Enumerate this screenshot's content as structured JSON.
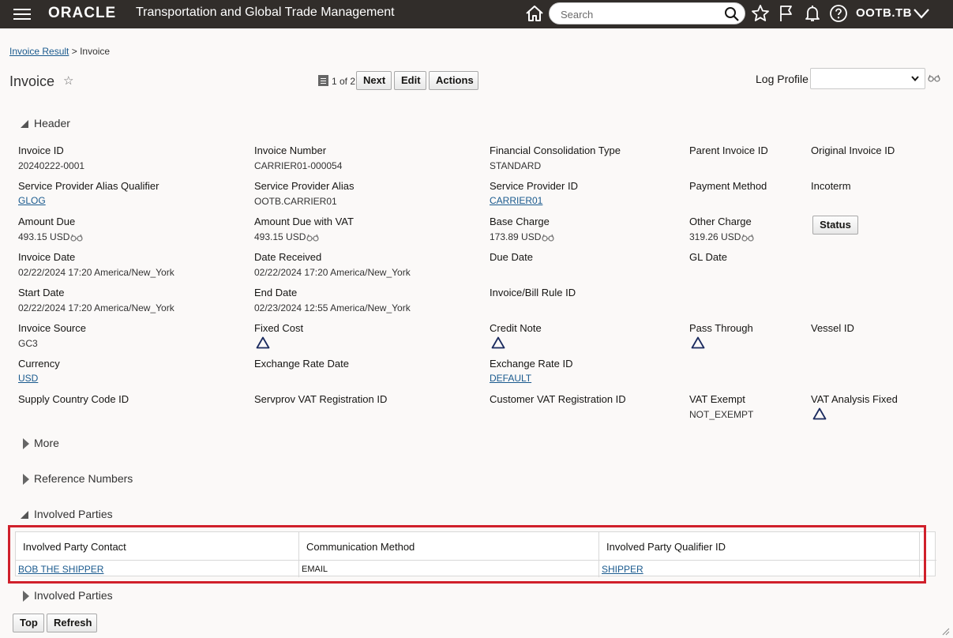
{
  "topbar": {
    "logo": "ORACLE",
    "app_title": "Transportation and Global Trade Management",
    "search_placeholder": "Search",
    "username": "OOTB.TB"
  },
  "breadcrumb": {
    "parent": "Invoice Result",
    "separator": ">",
    "current": "Invoice"
  },
  "page": {
    "title": "Invoice",
    "pager": "1 of 2",
    "buttons": {
      "next": "Next",
      "edit": "Edit",
      "actions": "Actions"
    },
    "log_profile_label": "Log Profile",
    "log_profile_value": ""
  },
  "header_section": {
    "title": "Header",
    "fields": {
      "invoice_id": {
        "label": "Invoice ID",
        "value": "20240222-0001"
      },
      "invoice_number": {
        "label": "Invoice Number",
        "value": "CARRIER01-000054"
      },
      "fin_consolidation_type": {
        "label": "Financial Consolidation Type",
        "value": "STANDARD"
      },
      "parent_invoice_id": {
        "label": "Parent Invoice ID",
        "value": ""
      },
      "original_invoice_id": {
        "label": "Original Invoice ID",
        "value": ""
      },
      "sp_alias_qualifier": {
        "label": "Service Provider Alias Qualifier",
        "value": "GLOG"
      },
      "sp_alias": {
        "label": "Service Provider Alias",
        "value": "OOTB.CARRIER01"
      },
      "sp_id": {
        "label": "Service Provider ID",
        "value": "CARRIER01"
      },
      "payment_method": {
        "label": "Payment Method",
        "value": ""
      },
      "incoterm": {
        "label": "Incoterm",
        "value": ""
      },
      "amount_due": {
        "label": "Amount Due",
        "value": "493.15 USD"
      },
      "amount_due_vat": {
        "label": "Amount Due with VAT",
        "value": "493.15 USD"
      },
      "base_charge": {
        "label": "Base Charge",
        "value": "173.89 USD"
      },
      "other_charge": {
        "label": "Other Charge",
        "value": "319.26 USD"
      },
      "status_button": "Status",
      "invoice_date": {
        "label": "Invoice Date",
        "value": "02/22/2024 17:20 America/New_York"
      },
      "date_received": {
        "label": "Date Received",
        "value": "02/22/2024 17:20 America/New_York"
      },
      "due_date": {
        "label": "Due Date",
        "value": ""
      },
      "gl_date": {
        "label": "GL Date",
        "value": ""
      },
      "start_date": {
        "label": "Start Date",
        "value": "02/22/2024 17:20 America/New_York"
      },
      "end_date": {
        "label": "End Date",
        "value": "02/23/2024 12:55 America/New_York"
      },
      "bill_rule_id": {
        "label": "Invoice/Bill Rule ID",
        "value": ""
      },
      "invoice_source": {
        "label": "Invoice Source",
        "value": "GC3"
      },
      "fixed_cost": {
        "label": "Fixed Cost"
      },
      "credit_note": {
        "label": "Credit Note"
      },
      "pass_through": {
        "label": "Pass Through"
      },
      "vessel_id": {
        "label": "Vessel ID",
        "value": ""
      },
      "currency": {
        "label": "Currency",
        "value": "USD"
      },
      "exchange_rate_date": {
        "label": "Exchange Rate Date",
        "value": ""
      },
      "exchange_rate_id": {
        "label": "Exchange Rate ID",
        "value": "DEFAULT"
      },
      "supply_country": {
        "label": "Supply Country Code ID",
        "value": ""
      },
      "servprov_vat": {
        "label": "Servprov VAT Registration ID",
        "value": ""
      },
      "customer_vat": {
        "label": "Customer VAT Registration ID",
        "value": ""
      },
      "vat_exempt": {
        "label": "VAT Exempt",
        "value": "NOT_EXEMPT"
      },
      "vat_analysis_fixed": {
        "label": "VAT Analysis Fixed"
      }
    }
  },
  "sections": {
    "more": "More",
    "reference_numbers": "Reference Numbers",
    "involved_parties": "Involved Parties",
    "involved_parties_2": "Involved Parties"
  },
  "involved_table": {
    "columns": [
      "Involved Party Contact",
      "Communication Method",
      "Involved Party Qualifier ID"
    ],
    "rows": [
      {
        "contact": "BOB THE SHIPPER",
        "method": "EMAIL",
        "qualifier": "SHIPPER"
      }
    ]
  },
  "footer": {
    "top": "Top",
    "refresh": "Refresh"
  },
  "colors": {
    "topbar": "#312d2a",
    "link": "#1a5a8e",
    "highlight": "#d0202b",
    "background": "#fbf9f8"
  }
}
